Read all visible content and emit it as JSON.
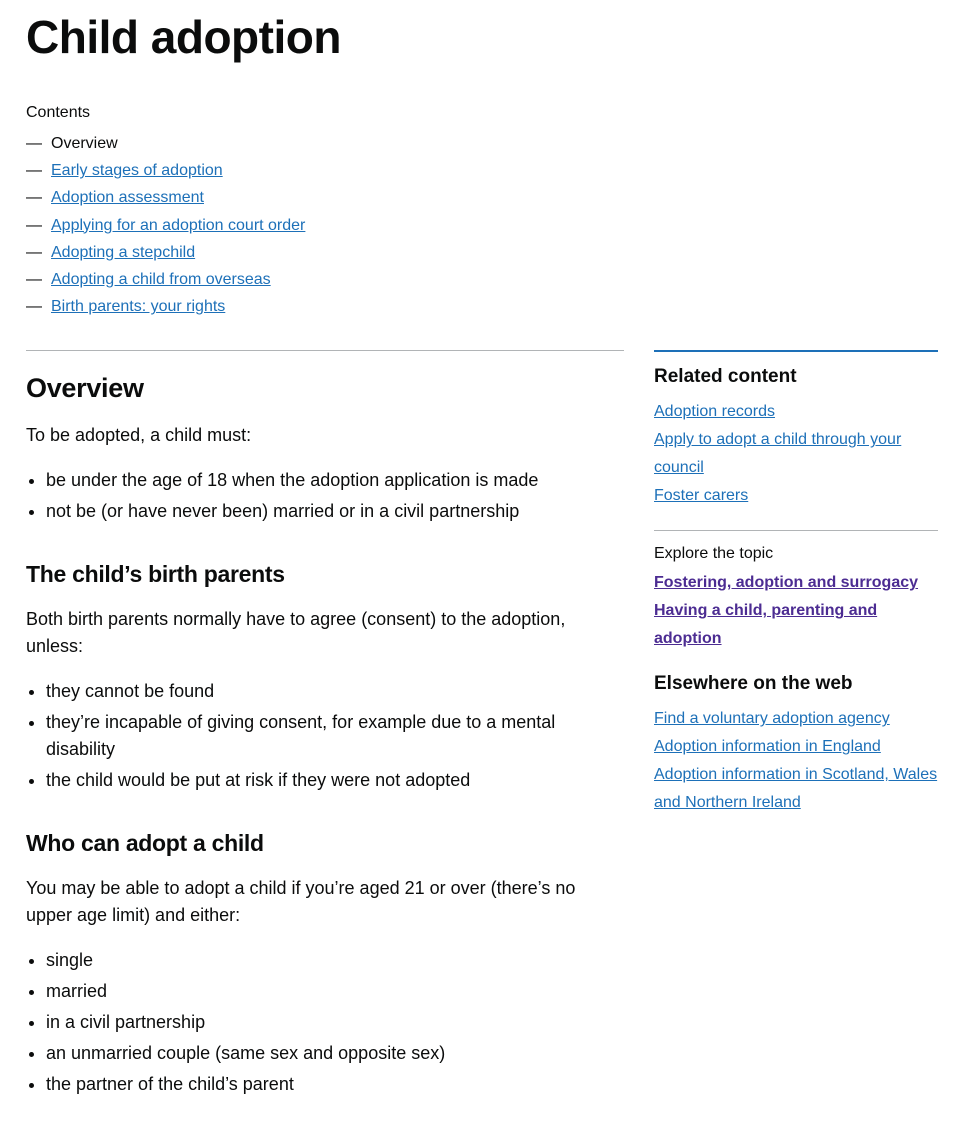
{
  "title": "Child adoption",
  "contents": {
    "label": "Contents",
    "items": [
      {
        "label": "Overview",
        "current": true
      },
      {
        "label": "Early stages of adoption",
        "current": false
      },
      {
        "label": "Adoption assessment",
        "current": false
      },
      {
        "label": "Applying for an adoption court order",
        "current": false
      },
      {
        "label": "Adopting a stepchild",
        "current": false
      },
      {
        "label": "Adopting a child from overseas",
        "current": false
      },
      {
        "label": "Birth parents: your rights",
        "current": false
      }
    ]
  },
  "main": {
    "heading": "Overview",
    "intro": "To be adopted, a child must:",
    "intro_list": [
      "be under the age of 18 when the adoption application is made",
      "not be (or have never been) married or in a civil partnership"
    ],
    "sec1_heading": "The child’s birth parents",
    "sec1_intro": "Both birth parents normally have to agree (consent) to the adoption, unless:",
    "sec1_list": [
      "they cannot be found",
      "they’re incapable of giving consent, for example due to a mental disability",
      "the child would be put at risk if they were not adopted"
    ],
    "sec2_heading": "Who can adopt a child",
    "sec2_intro": "You may be able to adopt a child if you’re aged 21 or over (there’s no upper age limit) and either:",
    "sec2_list": [
      "single",
      "married",
      "in a civil partnership",
      "an unmarried couple (same sex and opposite sex)",
      "the partner of the child’s parent"
    ]
  },
  "related": {
    "heading": "Related content",
    "links": [
      "Adoption records",
      "Apply to adopt a child through your council",
      "Foster carers"
    ]
  },
  "explore": {
    "label": "Explore the topic",
    "links": [
      "Fostering, adoption and surrogacy",
      "Having a child, parenting and adoption"
    ]
  },
  "elsewhere": {
    "heading": "Elsewhere on the web",
    "links": [
      "Find a voluntary adoption agency",
      "Adoption information in England",
      "Adoption information in Scotland, Wales and Northern Ireland"
    ]
  }
}
